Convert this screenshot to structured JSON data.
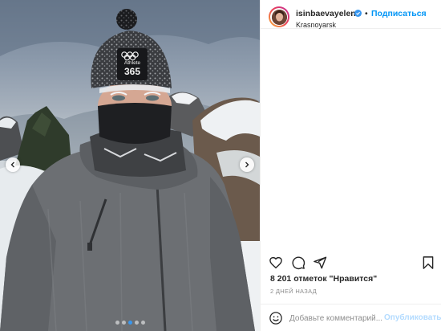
{
  "post": {
    "username": "isinbaevayelena",
    "follow_label": "Подписаться",
    "separator": "•",
    "location": "Krasnoyarsk",
    "likes_text": "8 201 отметок \"Нравится\"",
    "time_text": "2 ДНЕЙ НАЗАД"
  },
  "hat": {
    "text_top": "Athlete",
    "text_bottom": "365"
  },
  "comment": {
    "placeholder": "Добавьте комментарий...",
    "publish_label": "Опубликовать"
  },
  "carousel": {
    "slide_count": 5,
    "active_index": 2
  },
  "colors": {
    "accent": "#0095f6",
    "publish_disabled": "#b3dbff",
    "carousel_active": "#3897f0",
    "verified": "#3897f0"
  },
  "icons": {
    "like": "heart-icon",
    "comment": "comment-icon",
    "share": "paper-plane-icon",
    "save": "bookmark-icon",
    "emoji": "smiley-icon",
    "verified": "verified-badge-icon",
    "prev": "chevron-left-icon",
    "next": "chevron-right-icon"
  }
}
